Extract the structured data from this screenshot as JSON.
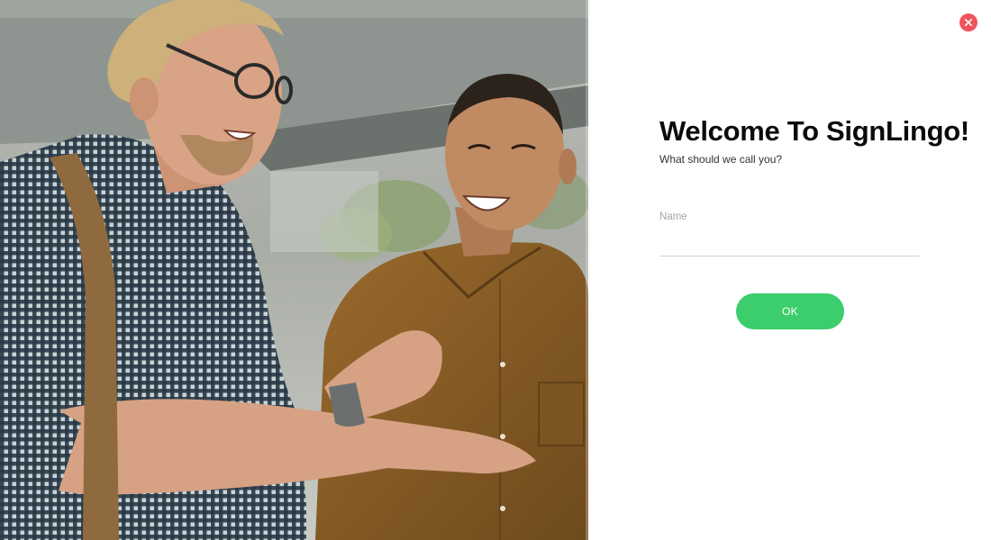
{
  "dialog": {
    "title": "Welcome To SignLingo!",
    "subtitle": "What should we call you?",
    "name_field": {
      "label": "Name",
      "value": ""
    },
    "ok_label": "OK",
    "close_icon": "close-icon"
  },
  "colors": {
    "close_button": "#f0545c",
    "ok_button": "#3ccd6c",
    "title_text": "#0b0b0b",
    "input_underline": "#cfcfcf"
  }
}
